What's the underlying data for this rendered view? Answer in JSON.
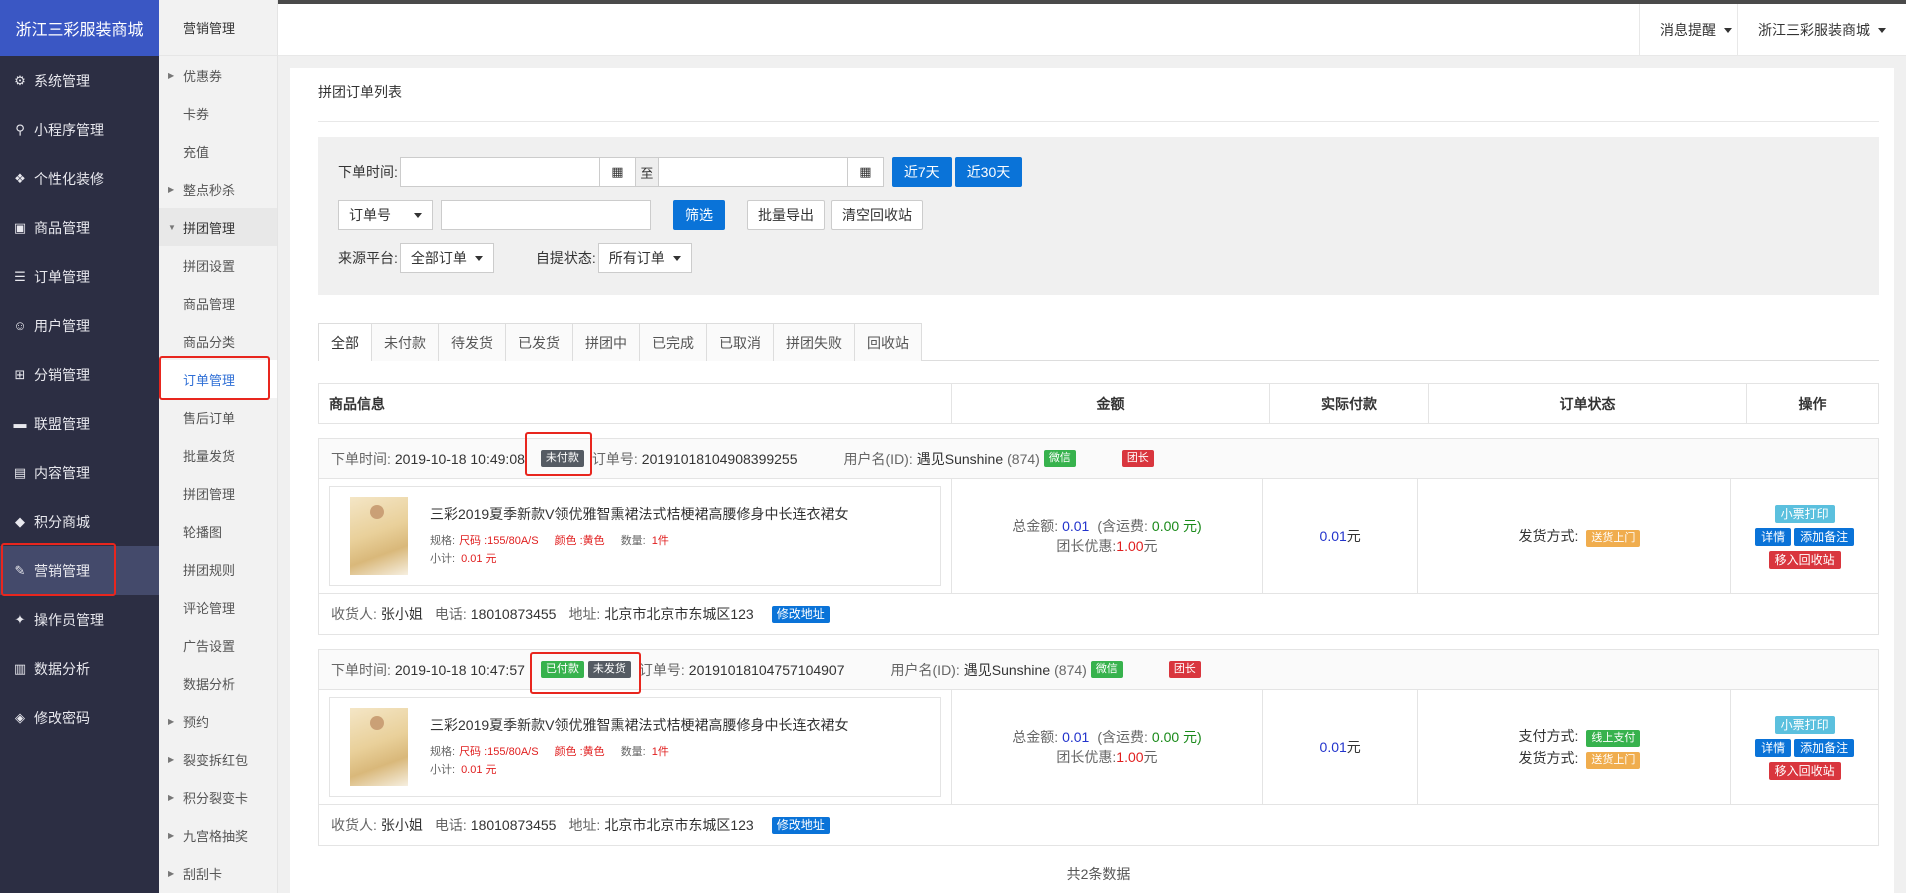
{
  "brand": "浙江三彩服装商城",
  "sidebar": {
    "items": [
      {
        "label": "系统管理",
        "icon": "gear-icon",
        "glyph": "⚙"
      },
      {
        "label": "小程序管理",
        "icon": "link-icon",
        "glyph": "⚲"
      },
      {
        "label": "个性化装修",
        "icon": "palette-icon",
        "glyph": "❖"
      },
      {
        "label": "商品管理",
        "icon": "bag-icon",
        "glyph": "▣"
      },
      {
        "label": "订单管理",
        "icon": "list-icon",
        "glyph": "☰"
      },
      {
        "label": "用户管理",
        "icon": "user-icon",
        "glyph": "☺"
      },
      {
        "label": "分销管理",
        "icon": "sitemap-icon",
        "glyph": "⊞"
      },
      {
        "label": "联盟管理",
        "icon": "card-icon",
        "glyph": "▬"
      },
      {
        "label": "内容管理",
        "icon": "content-icon",
        "glyph": "▤"
      },
      {
        "label": "积分商城",
        "icon": "box-icon",
        "glyph": "◆"
      },
      {
        "label": "营销管理",
        "icon": "marketing-icon",
        "glyph": "✎"
      },
      {
        "label": "操作员管理",
        "icon": "operator-icon",
        "glyph": "✦"
      },
      {
        "label": "数据分析",
        "icon": "chart-icon",
        "glyph": "▥"
      },
      {
        "label": "修改密码",
        "icon": "shield-icon",
        "glyph": "◈"
      }
    ]
  },
  "subnav": {
    "title": "营销管理",
    "items": [
      {
        "label": "优惠券",
        "arrow": "▶"
      },
      {
        "label": "卡券",
        "arrow": ""
      },
      {
        "label": "充值",
        "arrow": ""
      },
      {
        "label": "整点秒杀",
        "arrow": "▶"
      },
      {
        "label": "拼团管理",
        "arrow": "▼"
      },
      {
        "label": "拼团设置",
        "arrow": ""
      },
      {
        "label": "商品管理",
        "arrow": ""
      },
      {
        "label": "商品分类",
        "arrow": ""
      },
      {
        "label": "订单管理",
        "arrow": ""
      },
      {
        "label": "售后订单",
        "arrow": ""
      },
      {
        "label": "批量发货",
        "arrow": ""
      },
      {
        "label": "拼团管理",
        "arrow": ""
      },
      {
        "label": "轮播图",
        "arrow": ""
      },
      {
        "label": "拼团规则",
        "arrow": ""
      },
      {
        "label": "评论管理",
        "arrow": ""
      },
      {
        "label": "广告设置",
        "arrow": ""
      },
      {
        "label": "数据分析",
        "arrow": ""
      },
      {
        "label": "预约",
        "arrow": "▶"
      },
      {
        "label": "裂变拆红包",
        "arrow": "▶"
      },
      {
        "label": "积分裂变卡",
        "arrow": "▶"
      },
      {
        "label": "九宫格抽奖",
        "arrow": "▶"
      },
      {
        "label": "刮刮卡",
        "arrow": "▶"
      }
    ]
  },
  "topbar": {
    "notify": "消息提醒",
    "shop": "浙江三彩服装商城"
  },
  "page": {
    "title": "拼团订单列表",
    "filter": {
      "date_label": "下单时间:",
      "to": "至",
      "calendar_glyph": "▦",
      "btn_7days": "近7天",
      "btn_30days": "近30天",
      "field_select": "订单号",
      "btn_filter": "筛选",
      "btn_export": "批量导出",
      "btn_clear": "清空回收站",
      "source_label": "来源平台:",
      "source_value": "全部订单",
      "pickup_label": "自提状态:",
      "pickup_value": "所有订单"
    },
    "tabs": [
      "全部",
      "未付款",
      "待发货",
      "已发货",
      "拼团中",
      "已完成",
      "已取消",
      "拼团失败",
      "回收站"
    ],
    "columns": [
      "商品信息",
      "金额",
      "实际付款",
      "订单状态",
      "操作"
    ],
    "orders": [
      {
        "time_label": "下单时间:",
        "time": "2019-10-18 10:49:08",
        "badges": [
          "未付款"
        ],
        "no_label": "订单号:",
        "no": "20191018104908399255",
        "user_label": "用户名(ID):",
        "user": "遇见Sunshine",
        "uid": "(874)",
        "wechat": "微信",
        "leader": "团长",
        "goods_title": "三彩2019夏季新款V领优雅智熏裙法式桔梗裙高腰修身中长连衣裙女",
        "spec_label": "规格:",
        "size": "尺码 :155/80A/S",
        "color": "颜色 :黄色",
        "qty_label": "数量:",
        "qty": "1件",
        "subtotal_label": "小计:",
        "subtotal": "0.01 元",
        "total_label": "总金额:",
        "total": "0.01",
        "freight_pre": "(含运费:",
        "freight": "0.00 元)",
        "discount_label": "团长优惠:",
        "discount": "1.00",
        "discount_unit": "元",
        "paid": "0.01",
        "paid_unit": "元",
        "pay_label": "",
        "pay_value": "",
        "ship_label": "发货方式:",
        "ship_value": "送货上门",
        "op_print": "小票打印",
        "op_detail": "详情",
        "op_note": "添加备注",
        "op_recycle": "移入回收站",
        "receiver_label": "收货人:",
        "receiver": "张小姐",
        "phone_label": "电话:",
        "phone": "18010873455",
        "addr_label": "地址:",
        "addr": "北京市北京市东城区123",
        "edit_addr": "修改地址"
      },
      {
        "time_label": "下单时间:",
        "time": "2019-10-18 10:47:57",
        "badges": [
          "已付款",
          "未发货"
        ],
        "no_label": "订单号:",
        "no": "20191018104757104907",
        "user_label": "用户名(ID):",
        "user": "遇见Sunshine",
        "uid": "(874)",
        "wechat": "微信",
        "leader": "团长",
        "goods_title": "三彩2019夏季新款V领优雅智熏裙法式桔梗裙高腰修身中长连衣裙女",
        "spec_label": "规格:",
        "size": "尺码 :155/80A/S",
        "color": "颜色 :黄色",
        "qty_label": "数量:",
        "qty": "1件",
        "subtotal_label": "小计:",
        "subtotal": "0.01 元",
        "total_label": "总金额:",
        "total": "0.01",
        "freight_pre": "(含运费:",
        "freight": "0.00 元)",
        "discount_label": "团长优惠:",
        "discount": "1.00",
        "discount_unit": "元",
        "paid": "0.01",
        "paid_unit": "元",
        "pay_label": "支付方式:",
        "pay_value": "线上支付",
        "ship_label": "发货方式:",
        "ship_value": "送货上门",
        "op_print": "小票打印",
        "op_detail": "详情",
        "op_note": "添加备注",
        "op_recycle": "移入回收站",
        "receiver_label": "收货人:",
        "receiver": "张小姐",
        "phone_label": "电话:",
        "phone": "18010873455",
        "addr_label": "地址:",
        "addr": "北京市北京市东城区123",
        "edit_addr": "修改地址"
      }
    ],
    "total_count": "共2条数据"
  },
  "colors": {
    "brand_bg": "#3a57c4",
    "sidebar_bg": "#2c2e43",
    "primary": "#0a73d8",
    "highlight_box": "#e8261e"
  }
}
